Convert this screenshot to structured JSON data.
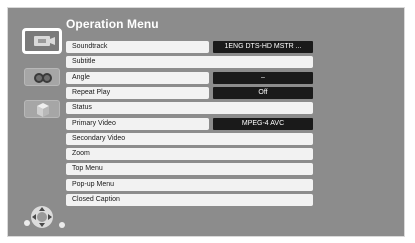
{
  "menu": {
    "title": "Operation Menu",
    "items": [
      {
        "label": "Soundtrack",
        "value": "1ENG DTS-HD MSTR ..."
      },
      {
        "label": "Subtitle",
        "value": ""
      },
      {
        "label": "Angle",
        "value": "–"
      },
      {
        "label": "Repeat Play",
        "value": "Off"
      },
      {
        "label": "Status",
        "value": ""
      },
      {
        "label": "Primary Video",
        "value": "MPEG-4 AVC"
      },
      {
        "label": "Secondary Video",
        "value": ""
      },
      {
        "label": "Zoom",
        "value": ""
      },
      {
        "label": "Top Menu",
        "value": ""
      },
      {
        "label": "Pop-up Menu",
        "value": ""
      },
      {
        "label": "Closed Caption",
        "value": ""
      }
    ]
  },
  "icons": {
    "disc": "disc-icon",
    "sd_card": "sd-card-icon",
    "box": "box-icon",
    "navigation": "navigation-pad-icon"
  },
  "colors": {
    "background": "#8c8c8c",
    "row": "#f2f2f2",
    "value_box": "#1a1a1a",
    "text_light": "#ffffff"
  }
}
